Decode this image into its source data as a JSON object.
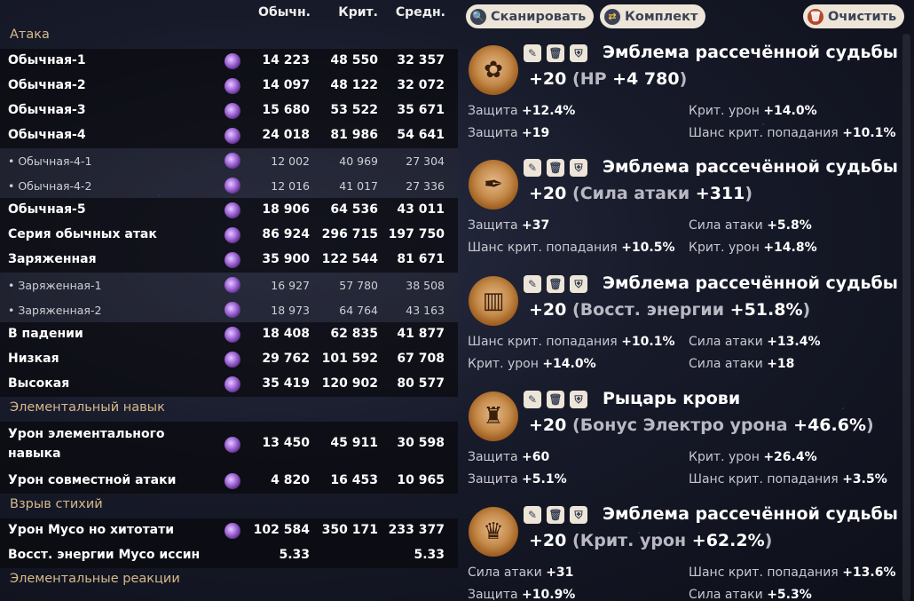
{
  "table": {
    "headers": [
      "Обычн.",
      "Крит.",
      "Средн."
    ],
    "rows": [
      {
        "kind": "section",
        "label": "Атака"
      },
      {
        "kind": "main",
        "label": "Обычная-1",
        "vals": [
          "14 223",
          "48 550",
          "32 357"
        ]
      },
      {
        "kind": "main",
        "label": "Обычная-2",
        "vals": [
          "14 097",
          "48 122",
          "32 072"
        ]
      },
      {
        "kind": "main",
        "label": "Обычная-3",
        "vals": [
          "15 680",
          "53 522",
          "35 671"
        ]
      },
      {
        "kind": "main",
        "label": "Обычная-4",
        "vals": [
          "24 018",
          "81 986",
          "54 641"
        ]
      },
      {
        "kind": "sub",
        "label": "• Обычная-4-1",
        "vals": [
          "12 002",
          "40 969",
          "27 304"
        ]
      },
      {
        "kind": "sub",
        "label": "• Обычная-4-2",
        "vals": [
          "12 016",
          "41 017",
          "27 336"
        ]
      },
      {
        "kind": "main",
        "label": "Обычная-5",
        "vals": [
          "18 906",
          "64 536",
          "43 011"
        ]
      },
      {
        "kind": "main",
        "label": "Серия обычных атак",
        "vals": [
          "86 924",
          "296 715",
          "197 750"
        ]
      },
      {
        "kind": "main",
        "label": "Заряженная",
        "vals": [
          "35 900",
          "122 544",
          "81 671"
        ]
      },
      {
        "kind": "sub",
        "label": "• Заряженная-1",
        "vals": [
          "16 927",
          "57 780",
          "38 508"
        ]
      },
      {
        "kind": "sub",
        "label": "• Заряженная-2",
        "vals": [
          "18 973",
          "64 764",
          "43 163"
        ]
      },
      {
        "kind": "main",
        "label": "В падении",
        "vals": [
          "18 408",
          "62 835",
          "41 877"
        ]
      },
      {
        "kind": "main",
        "label": "Низкая",
        "vals": [
          "29 762",
          "101 592",
          "67 708"
        ]
      },
      {
        "kind": "main",
        "label": "Высокая",
        "vals": [
          "35 419",
          "120 902",
          "80 577"
        ]
      },
      {
        "kind": "section",
        "label": "Элементальный навык"
      },
      {
        "kind": "main",
        "tall": true,
        "label": "Урон элементального навыка",
        "vals": [
          "13 450",
          "45 911",
          "30 598"
        ]
      },
      {
        "kind": "main",
        "label": "Урон совместной атаки",
        "vals": [
          "4 820",
          "16 453",
          "10 965"
        ]
      },
      {
        "kind": "section",
        "label": "Взрыв стихий"
      },
      {
        "kind": "main",
        "label": "Урон Мусо но хитотати",
        "vals": [
          "102 584",
          "350 171",
          "233 377"
        ]
      },
      {
        "kind": "main",
        "noicon": true,
        "label": "Восст. энергии Мусо иссин",
        "vals": [
          "5.33",
          "",
          "5.33"
        ]
      },
      {
        "kind": "section",
        "label": "Элементальные реакции"
      }
    ]
  },
  "toolbar": {
    "scan": "Сканировать",
    "set": "Комплект",
    "clear": "Очистить"
  },
  "artifacts": [
    {
      "name": "Эмблема рассечённой судьбы",
      "level": "+20",
      "main_key": "HP",
      "main_val": "+4 780",
      "subs": [
        [
          "Защита",
          "+12.4%"
        ],
        [
          "Крит. урон",
          "+14.0%"
        ],
        [
          "Защита",
          "+19"
        ],
        [
          "Шанс крит. попадания",
          "+10.1%"
        ]
      ]
    },
    {
      "name": "Эмблема рассечённой судьбы",
      "level": "+20",
      "main_key": "Сила атаки",
      "main_val": "+311",
      "subs": [
        [
          "Защита",
          "+37"
        ],
        [
          "Сила атаки",
          "+5.8%"
        ],
        [
          "Шанс крит. попадания",
          "+10.5%"
        ],
        [
          "Крит. урон",
          "+14.8%"
        ]
      ]
    },
    {
      "name": "Эмблема рассечённой судьбы",
      "level": "+20",
      "main_key": "Восст. энергии",
      "main_val": "+51.8%",
      "subs": [
        [
          "Шанс крит. попадания",
          "+10.1%"
        ],
        [
          "Сила атаки",
          "+13.4%"
        ],
        [
          "Крит. урон",
          "+14.0%"
        ],
        [
          "Сила атаки",
          "+18"
        ]
      ]
    },
    {
      "name": "Рыцарь крови",
      "level": "+20",
      "main_key": "Бонус Электро урона",
      "main_val": "+46.6%",
      "subs": [
        [
          "Защита",
          "+60"
        ],
        [
          "Крит. урон",
          "+26.4%"
        ],
        [
          "Защита",
          "+5.1%"
        ],
        [
          "Шанс крит. попадания",
          "+3.5%"
        ]
      ]
    },
    {
      "name": "Эмблема рассечённой судьбы",
      "level": "+20",
      "main_key": "Крит. урон",
      "main_val": "+62.2%",
      "subs": [
        [
          "Сила атаки",
          "+31"
        ],
        [
          "Шанс крит. попадания",
          "+13.6%"
        ],
        [
          "Защита",
          "+10.9%"
        ],
        [
          "Сила атаки",
          "+5.3%"
        ]
      ]
    }
  ]
}
